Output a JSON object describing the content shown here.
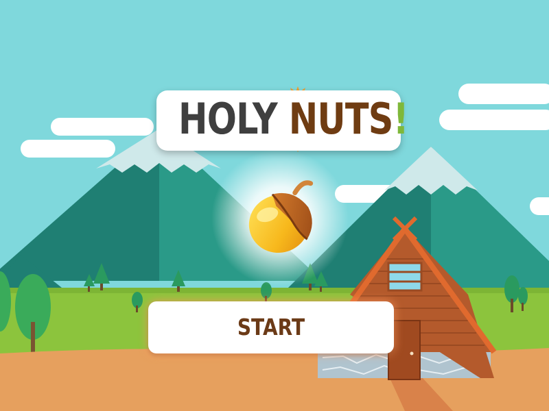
{
  "game": {
    "title_part1": "HOLY",
    "title_part2": "NUTS",
    "title_part3": "!",
    "start_label": "START"
  },
  "colors": {
    "sky": "#7fd8dc",
    "mountain_dark": "#1f7f73",
    "mountain_light": "#2a9a88",
    "snow": "#cfe9ea",
    "grass": "#8cc43d",
    "ground": "#e6a05e",
    "cabin_wood": "#b45a2c",
    "title_holy": "#3f3f3f",
    "title_nuts": "#6f3c12",
    "title_bang": "#7fb83a",
    "start_text": "#6b3a17"
  },
  "icons": {
    "mascot": "acorn-icon"
  }
}
